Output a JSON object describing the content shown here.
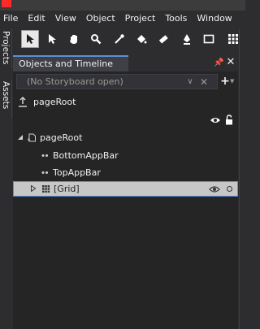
{
  "menu": {
    "items": [
      "File",
      "Edit",
      "View",
      "Object",
      "Project",
      "Tools",
      "Window"
    ]
  },
  "left_tabs": {
    "projects": "Projects",
    "assets": "Assets"
  },
  "toolbar": {
    "tools": [
      {
        "name": "selection-tool",
        "icon": "arrow-cursor-icon",
        "active": true
      },
      {
        "name": "direct-selection-tool",
        "icon": "direct-select-icon",
        "active": false
      },
      {
        "name": "pan-tool",
        "icon": "hand-icon",
        "active": false
      },
      {
        "name": "zoom-tool",
        "icon": "magnifier-icon",
        "active": false
      },
      {
        "name": "eyedropper-tool",
        "icon": "eyedropper-icon",
        "active": false
      },
      {
        "name": "paint-bucket-tool",
        "icon": "paint-bucket-icon",
        "active": false
      },
      {
        "name": "brush-transform-tool",
        "icon": "brush-transform-icon",
        "active": false
      },
      {
        "name": "pen-tool",
        "icon": "pen-icon",
        "active": false
      },
      {
        "name": "rectangle-tool",
        "icon": "rectangle-icon",
        "active": false
      },
      {
        "name": "grid-tool",
        "icon": "grid-icon",
        "active": false
      }
    ]
  },
  "panel": {
    "title": "Objects and Timeline",
    "pin_icon": "pin-icon",
    "close_icon": "close-icon",
    "storyboard": {
      "text": "(No Storyboard open)",
      "add_icon": "plus-icon"
    },
    "scope": {
      "label": "pageRoot"
    },
    "tree": {
      "root": {
        "label": "pageRoot",
        "expanded": true
      },
      "children": [
        {
          "label": "BottomAppBar"
        },
        {
          "label": "TopAppBar"
        },
        {
          "label": "[Grid]",
          "selected": true,
          "expanded": false
        }
      ]
    }
  },
  "colors": {
    "background": "#2d2d30",
    "panel": "#252526",
    "accent": "#5b8fd8",
    "selected_row": "#c7c7c7",
    "text": "#f1f1f1"
  }
}
